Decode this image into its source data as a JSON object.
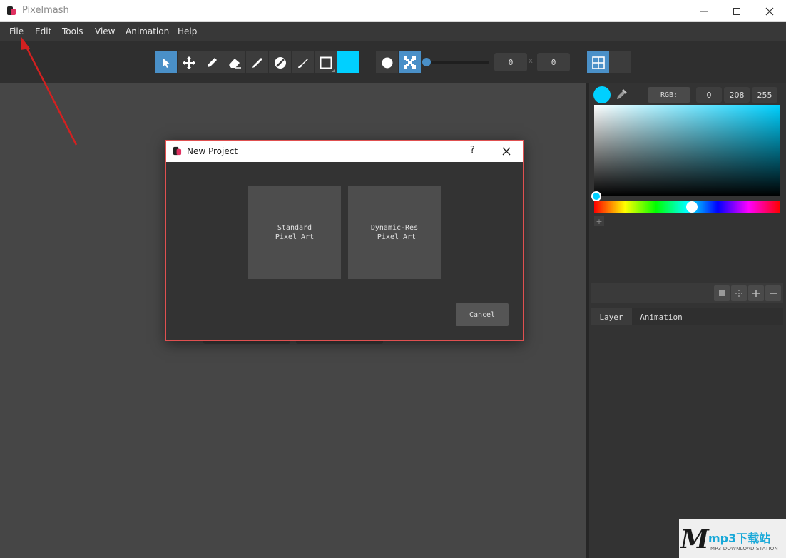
{
  "window": {
    "title": "Pixelmash"
  },
  "menu": {
    "items": [
      "File",
      "Edit",
      "Tools",
      "View",
      "Animation",
      "Help"
    ]
  },
  "toolbar": {
    "tools": [
      "pointer-icon",
      "move-icon",
      "pencil-icon",
      "eraser-icon",
      "line-icon",
      "fill-icon",
      "brush-icon",
      "rectangle-icon"
    ],
    "current_color": "#00d0ff",
    "offset_x": "0",
    "offset_y": "0",
    "separator": "x"
  },
  "color_panel": {
    "mode_label": "RGB:",
    "r": "0",
    "g": "208",
    "b": "255",
    "add_swatch": "+"
  },
  "tabs": [
    "Layer",
    "Animation"
  ],
  "dialog": {
    "title": "New Project",
    "help": "?",
    "options": [
      "Standard\nPixel Art",
      "Dynamic-Res\n Pixel Art"
    ],
    "cancel_label": "Cancel"
  },
  "watermark": {
    "letter": "M",
    "text": "mp3下载站",
    "subtext": "MP3 DOWNLOAD STATION"
  },
  "colors": {
    "accent": "#4a90c8",
    "annotation": "#d42020"
  }
}
